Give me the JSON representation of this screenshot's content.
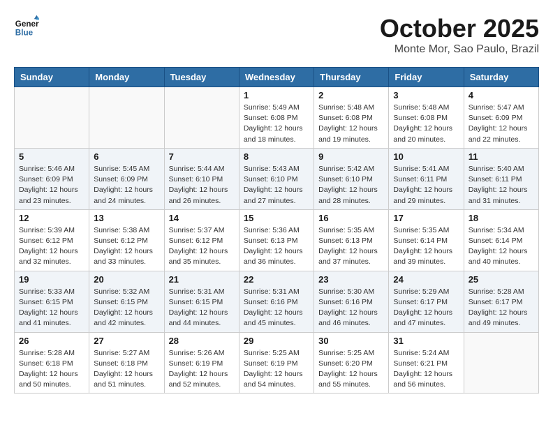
{
  "header": {
    "logo_line1": "General",
    "logo_line2": "Blue",
    "month": "October 2025",
    "location": "Monte Mor, Sao Paulo, Brazil"
  },
  "weekdays": [
    "Sunday",
    "Monday",
    "Tuesday",
    "Wednesday",
    "Thursday",
    "Friday",
    "Saturday"
  ],
  "weeks": [
    [
      {
        "day": "",
        "info": ""
      },
      {
        "day": "",
        "info": ""
      },
      {
        "day": "",
        "info": ""
      },
      {
        "day": "1",
        "info": "Sunrise: 5:49 AM\nSunset: 6:08 PM\nDaylight: 12 hours\nand 18 minutes."
      },
      {
        "day": "2",
        "info": "Sunrise: 5:48 AM\nSunset: 6:08 PM\nDaylight: 12 hours\nand 19 minutes."
      },
      {
        "day": "3",
        "info": "Sunrise: 5:48 AM\nSunset: 6:08 PM\nDaylight: 12 hours\nand 20 minutes."
      },
      {
        "day": "4",
        "info": "Sunrise: 5:47 AM\nSunset: 6:09 PM\nDaylight: 12 hours\nand 22 minutes."
      }
    ],
    [
      {
        "day": "5",
        "info": "Sunrise: 5:46 AM\nSunset: 6:09 PM\nDaylight: 12 hours\nand 23 minutes."
      },
      {
        "day": "6",
        "info": "Sunrise: 5:45 AM\nSunset: 6:09 PM\nDaylight: 12 hours\nand 24 minutes."
      },
      {
        "day": "7",
        "info": "Sunrise: 5:44 AM\nSunset: 6:10 PM\nDaylight: 12 hours\nand 26 minutes."
      },
      {
        "day": "8",
        "info": "Sunrise: 5:43 AM\nSunset: 6:10 PM\nDaylight: 12 hours\nand 27 minutes."
      },
      {
        "day": "9",
        "info": "Sunrise: 5:42 AM\nSunset: 6:10 PM\nDaylight: 12 hours\nand 28 minutes."
      },
      {
        "day": "10",
        "info": "Sunrise: 5:41 AM\nSunset: 6:11 PM\nDaylight: 12 hours\nand 29 minutes."
      },
      {
        "day": "11",
        "info": "Sunrise: 5:40 AM\nSunset: 6:11 PM\nDaylight: 12 hours\nand 31 minutes."
      }
    ],
    [
      {
        "day": "12",
        "info": "Sunrise: 5:39 AM\nSunset: 6:12 PM\nDaylight: 12 hours\nand 32 minutes."
      },
      {
        "day": "13",
        "info": "Sunrise: 5:38 AM\nSunset: 6:12 PM\nDaylight: 12 hours\nand 33 minutes."
      },
      {
        "day": "14",
        "info": "Sunrise: 5:37 AM\nSunset: 6:12 PM\nDaylight: 12 hours\nand 35 minutes."
      },
      {
        "day": "15",
        "info": "Sunrise: 5:36 AM\nSunset: 6:13 PM\nDaylight: 12 hours\nand 36 minutes."
      },
      {
        "day": "16",
        "info": "Sunrise: 5:35 AM\nSunset: 6:13 PM\nDaylight: 12 hours\nand 37 minutes."
      },
      {
        "day": "17",
        "info": "Sunrise: 5:35 AM\nSunset: 6:14 PM\nDaylight: 12 hours\nand 39 minutes."
      },
      {
        "day": "18",
        "info": "Sunrise: 5:34 AM\nSunset: 6:14 PM\nDaylight: 12 hours\nand 40 minutes."
      }
    ],
    [
      {
        "day": "19",
        "info": "Sunrise: 5:33 AM\nSunset: 6:15 PM\nDaylight: 12 hours\nand 41 minutes."
      },
      {
        "day": "20",
        "info": "Sunrise: 5:32 AM\nSunset: 6:15 PM\nDaylight: 12 hours\nand 42 minutes."
      },
      {
        "day": "21",
        "info": "Sunrise: 5:31 AM\nSunset: 6:15 PM\nDaylight: 12 hours\nand 44 minutes."
      },
      {
        "day": "22",
        "info": "Sunrise: 5:31 AM\nSunset: 6:16 PM\nDaylight: 12 hours\nand 45 minutes."
      },
      {
        "day": "23",
        "info": "Sunrise: 5:30 AM\nSunset: 6:16 PM\nDaylight: 12 hours\nand 46 minutes."
      },
      {
        "day": "24",
        "info": "Sunrise: 5:29 AM\nSunset: 6:17 PM\nDaylight: 12 hours\nand 47 minutes."
      },
      {
        "day": "25",
        "info": "Sunrise: 5:28 AM\nSunset: 6:17 PM\nDaylight: 12 hours\nand 49 minutes."
      }
    ],
    [
      {
        "day": "26",
        "info": "Sunrise: 5:28 AM\nSunset: 6:18 PM\nDaylight: 12 hours\nand 50 minutes."
      },
      {
        "day": "27",
        "info": "Sunrise: 5:27 AM\nSunset: 6:18 PM\nDaylight: 12 hours\nand 51 minutes."
      },
      {
        "day": "28",
        "info": "Sunrise: 5:26 AM\nSunset: 6:19 PM\nDaylight: 12 hours\nand 52 minutes."
      },
      {
        "day": "29",
        "info": "Sunrise: 5:25 AM\nSunset: 6:19 PM\nDaylight: 12 hours\nand 54 minutes."
      },
      {
        "day": "30",
        "info": "Sunrise: 5:25 AM\nSunset: 6:20 PM\nDaylight: 12 hours\nand 55 minutes."
      },
      {
        "day": "31",
        "info": "Sunrise: 5:24 AM\nSunset: 6:21 PM\nDaylight: 12 hours\nand 56 minutes."
      },
      {
        "day": "",
        "info": ""
      }
    ]
  ]
}
